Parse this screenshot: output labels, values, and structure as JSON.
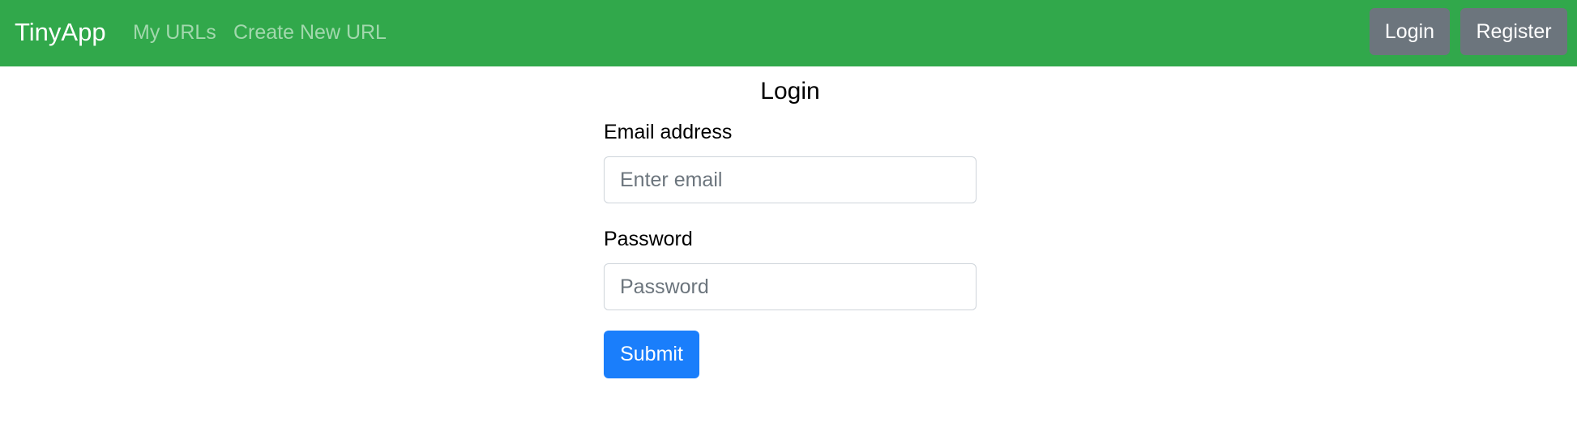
{
  "navbar": {
    "brand": "TinyApp",
    "links": [
      {
        "label": "My URLs"
      },
      {
        "label": "Create New URL"
      }
    ],
    "login_label": "Login",
    "register_label": "Register"
  },
  "form": {
    "title": "Login",
    "email": {
      "label": "Email address",
      "placeholder": "Enter email",
      "value": ""
    },
    "password": {
      "label": "Password",
      "placeholder": "Password",
      "value": ""
    },
    "submit_label": "Submit"
  },
  "colors": {
    "navbar_bg": "#31a84b",
    "nav_button_bg": "#6c757d",
    "submit_bg": "#1a7efb"
  }
}
